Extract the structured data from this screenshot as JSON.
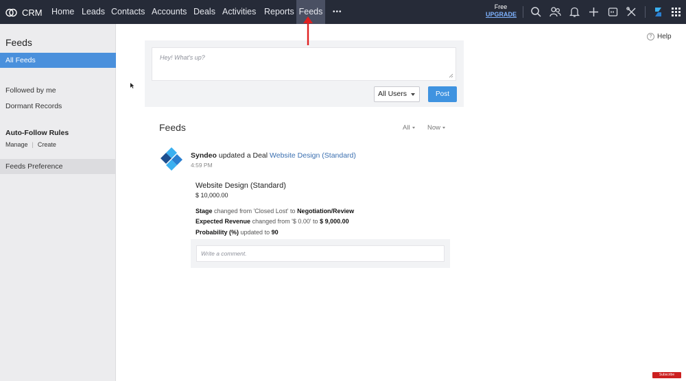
{
  "topbar": {
    "logo_text": "CRM",
    "nav": [
      {
        "label": "Home"
      },
      {
        "label": "Leads"
      },
      {
        "label": "Contacts"
      },
      {
        "label": "Accounts"
      },
      {
        "label": "Deals"
      },
      {
        "label": "Activities"
      },
      {
        "label": "Reports"
      },
      {
        "label": "Feeds"
      }
    ],
    "more_label": "•••",
    "plan_label": "Free",
    "upgrade_label": "UPGRADE",
    "active_tab": "Feeds"
  },
  "sidebar": {
    "title": "Feeds",
    "items": [
      {
        "label": "All Feeds"
      },
      {
        "label": "Followed by me"
      },
      {
        "label": "Dormant Records"
      }
    ],
    "autofollow": {
      "heading": "Auto-Follow Rules",
      "manage": "Manage",
      "create": "Create"
    },
    "preference": "Feeds Preference"
  },
  "composer": {
    "placeholder": "Hey! What's up?",
    "audience": "All Users",
    "post_label": "Post"
  },
  "help_label": "Help",
  "feed": {
    "title": "Feeds",
    "filter_type": "All",
    "filter_time": "Now",
    "item": {
      "actor": "Syndeo",
      "action": "updated a Deal",
      "record": "Website Design (Standard)",
      "time": "4:59 PM",
      "deal_name": "Website Design (Standard)",
      "amount": "$ 10,000.00",
      "changes": [
        {
          "field": "Stage",
          "verb": "changed from 'Closed Lost' to",
          "value": "Negotiation/Review"
        },
        {
          "field": "Expected Revenue",
          "verb": "changed from '$ 0.00' to",
          "value": "$ 9,000.00"
        },
        {
          "field": "Probability (%)",
          "verb": "updated to",
          "value": "90"
        }
      ],
      "comment_placeholder": "Write a comment."
    }
  },
  "youtube_badge": "Subscribe",
  "colors": {
    "topbar": "#262b38",
    "active_nav": "#4a5063",
    "accent": "#3f93e0",
    "sidebar_active": "#4a90dc",
    "link": "#3a6fb0",
    "arrow": "#e02020"
  }
}
